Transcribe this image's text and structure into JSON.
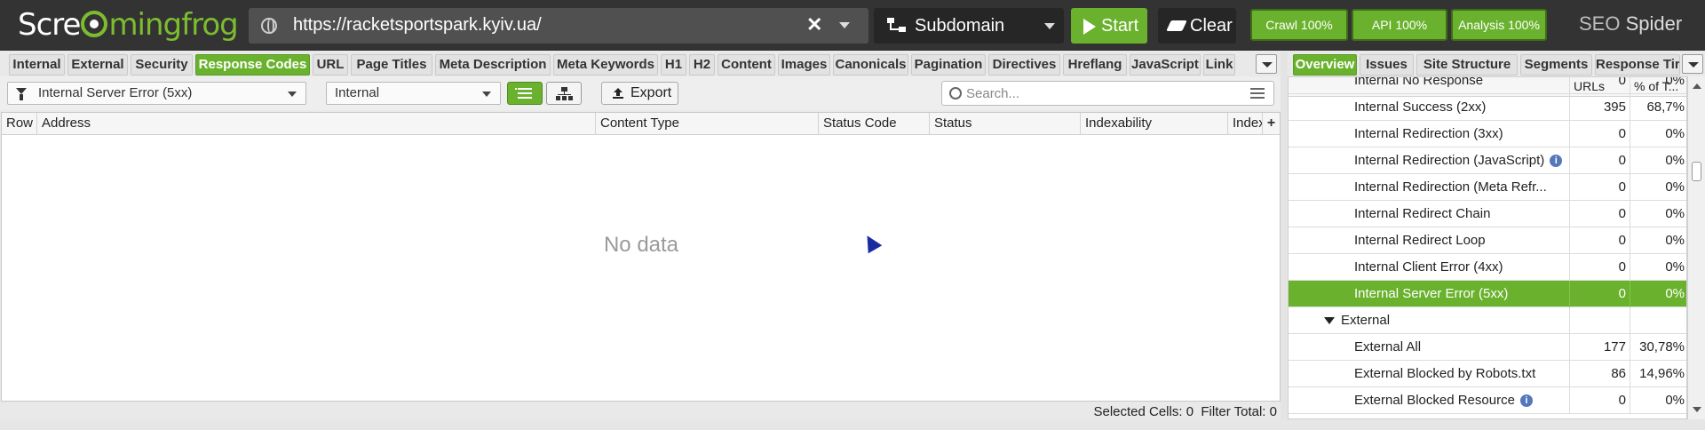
{
  "app": {
    "logo_prefix": "Scre",
    "logo_suffix": "mingfrog",
    "brand_seo": "SEO",
    "brand_spider": "Spider"
  },
  "toolbar": {
    "url": "https://racketsportspark.kyiv.ua/",
    "mode": "Subdomain",
    "start_label": "Start",
    "clear_label": "Clear",
    "crawl_label": "Crawl 100%",
    "api_label": "API 100%",
    "analysis_label": "Analysis 100%",
    "crawl_progress": 1.0,
    "api_progress": 1.0,
    "analysis_progress": 1.0
  },
  "left_tabs": [
    "Internal",
    "External",
    "Security",
    "Response Codes",
    "URL",
    "Page Titles",
    "Meta Description",
    "Meta Keywords",
    "H1",
    "H2",
    "Content",
    "Images",
    "Canonicals",
    "Pagination",
    "Directives",
    "Hreflang",
    "JavaScript",
    "Link"
  ],
  "left_tabs_active": "Response Codes",
  "filters": {
    "filter_value": "Internal Server Error (5xx)",
    "scope_value": "Internal",
    "export_label": "Export",
    "search_placeholder": "Search..."
  },
  "grid": {
    "columns": [
      "Row",
      "Address",
      "Content Type",
      "Status Code",
      "Status",
      "Indexability",
      "Indexa"
    ],
    "empty_text": "No data"
  },
  "status": {
    "selected_cells_label": "Selected Cells:",
    "selected_cells": "0",
    "filter_total_label": "Filter Total:",
    "filter_total": "0"
  },
  "right_tabs": [
    "Overview",
    "Issues",
    "Site Structure",
    "Segments",
    "Response Tir"
  ],
  "right_tabs_active": "Overview",
  "overview": {
    "col_urls": "URLs",
    "col_pct": "% of T...",
    "rows": [
      {
        "name": "Internal No Response",
        "urls": "0",
        "pct": "0%",
        "type": "item"
      },
      {
        "name": "Internal Success (2xx)",
        "urls": "395",
        "pct": "68,7%",
        "type": "item"
      },
      {
        "name": "Internal Redirection (3xx)",
        "urls": "0",
        "pct": "0%",
        "type": "item"
      },
      {
        "name": "Internal Redirection (JavaScript)",
        "urls": "0",
        "pct": "0%",
        "type": "item",
        "info": true
      },
      {
        "name": "Internal Redirection (Meta Refr...",
        "urls": "0",
        "pct": "0%",
        "type": "item"
      },
      {
        "name": "Internal Redirect Chain",
        "urls": "0",
        "pct": "0%",
        "type": "item"
      },
      {
        "name": "Internal Redirect Loop",
        "urls": "0",
        "pct": "0%",
        "type": "item"
      },
      {
        "name": "Internal Client Error (4xx)",
        "urls": "0",
        "pct": "0%",
        "type": "item"
      },
      {
        "name": "Internal Server Error (5xx)",
        "urls": "0",
        "pct": "0%",
        "type": "item",
        "selected": true
      },
      {
        "name": "External",
        "urls": "",
        "pct": "",
        "type": "group"
      },
      {
        "name": "External All",
        "urls": "177",
        "pct": "30,78%",
        "type": "item"
      },
      {
        "name": "External Blocked by Robots.txt",
        "urls": "86",
        "pct": "14,96%",
        "type": "item"
      },
      {
        "name": "External Blocked Resource",
        "urls": "0",
        "pct": "0%",
        "type": "item",
        "info": true
      }
    ]
  },
  "colors": {
    "accent": "#6ab22e",
    "topbar": "#333333",
    "cursor": "#1a2aa0"
  },
  "icons": [
    "globe-icon",
    "clear-url-icon",
    "dropdown-caret-icon",
    "sitemap-icon",
    "play-icon",
    "eraser-icon",
    "filter-icon",
    "list-view-icon",
    "tree-view-icon",
    "export-icon",
    "search-icon",
    "search-options-icon",
    "add-column-icon",
    "info-icon",
    "expand-triangle-icon",
    "mouse-cursor-icon"
  ]
}
